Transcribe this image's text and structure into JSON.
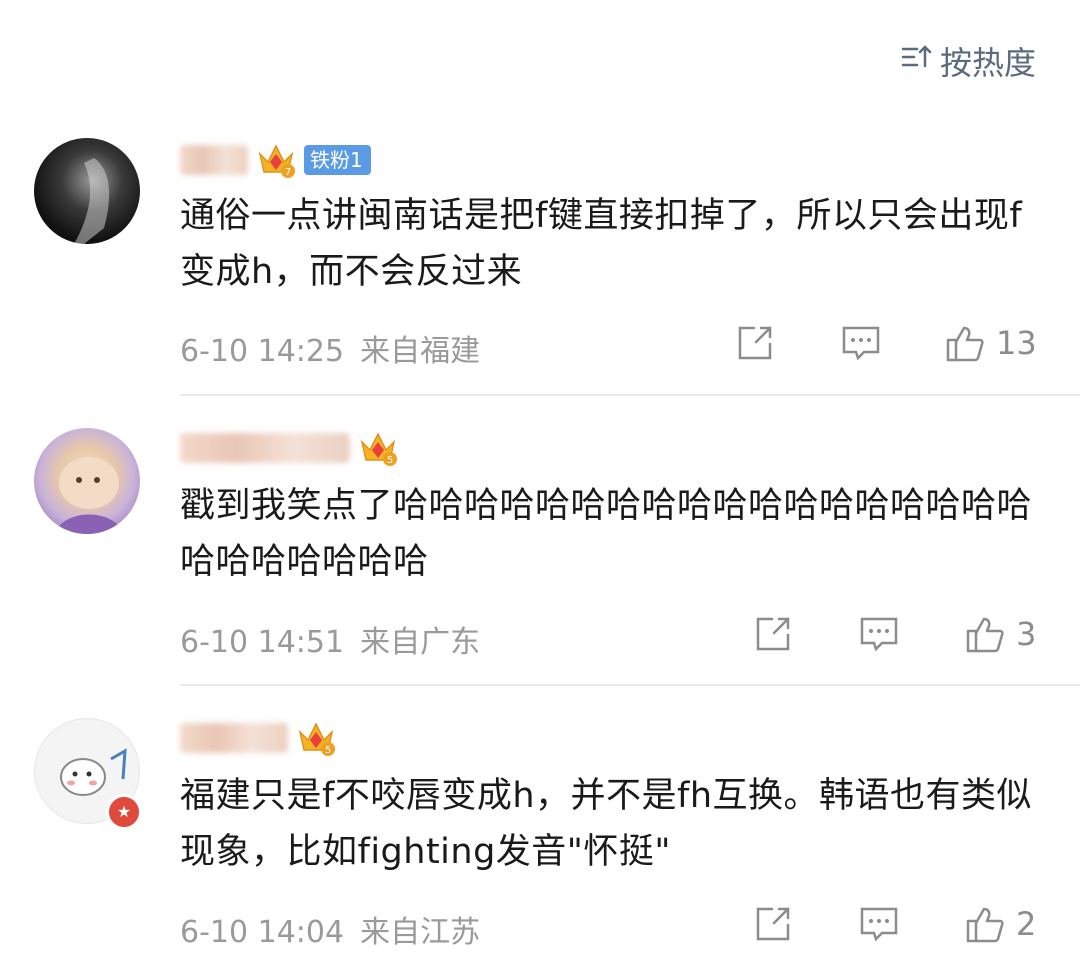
{
  "sort": {
    "label": "按热度"
  },
  "comments": [
    {
      "fan_tag": "铁粉1",
      "crown_level": "7",
      "text": "通俗一点讲闽南话是把f键直接扣掉了，所以只会出现f变成h，而不会反过来",
      "time": "6-10 14:25",
      "location": "来自福建",
      "likes": "13"
    },
    {
      "crown_level": "5",
      "text": "戳到我笑点了哈哈哈哈哈哈哈哈哈哈哈哈哈哈哈哈哈哈哈哈哈哈哈哈哈",
      "time": "6-10 14:51",
      "location": "来自广东",
      "likes": "3"
    },
    {
      "crown_level": "5",
      "text": "福建只是f不咬唇变成h，并不是fh互换。韩语也有类似现象，比如fighting发音\"怀挺\"",
      "time": "6-10 14:04",
      "location": "来自江苏",
      "likes": "2"
    }
  ]
}
